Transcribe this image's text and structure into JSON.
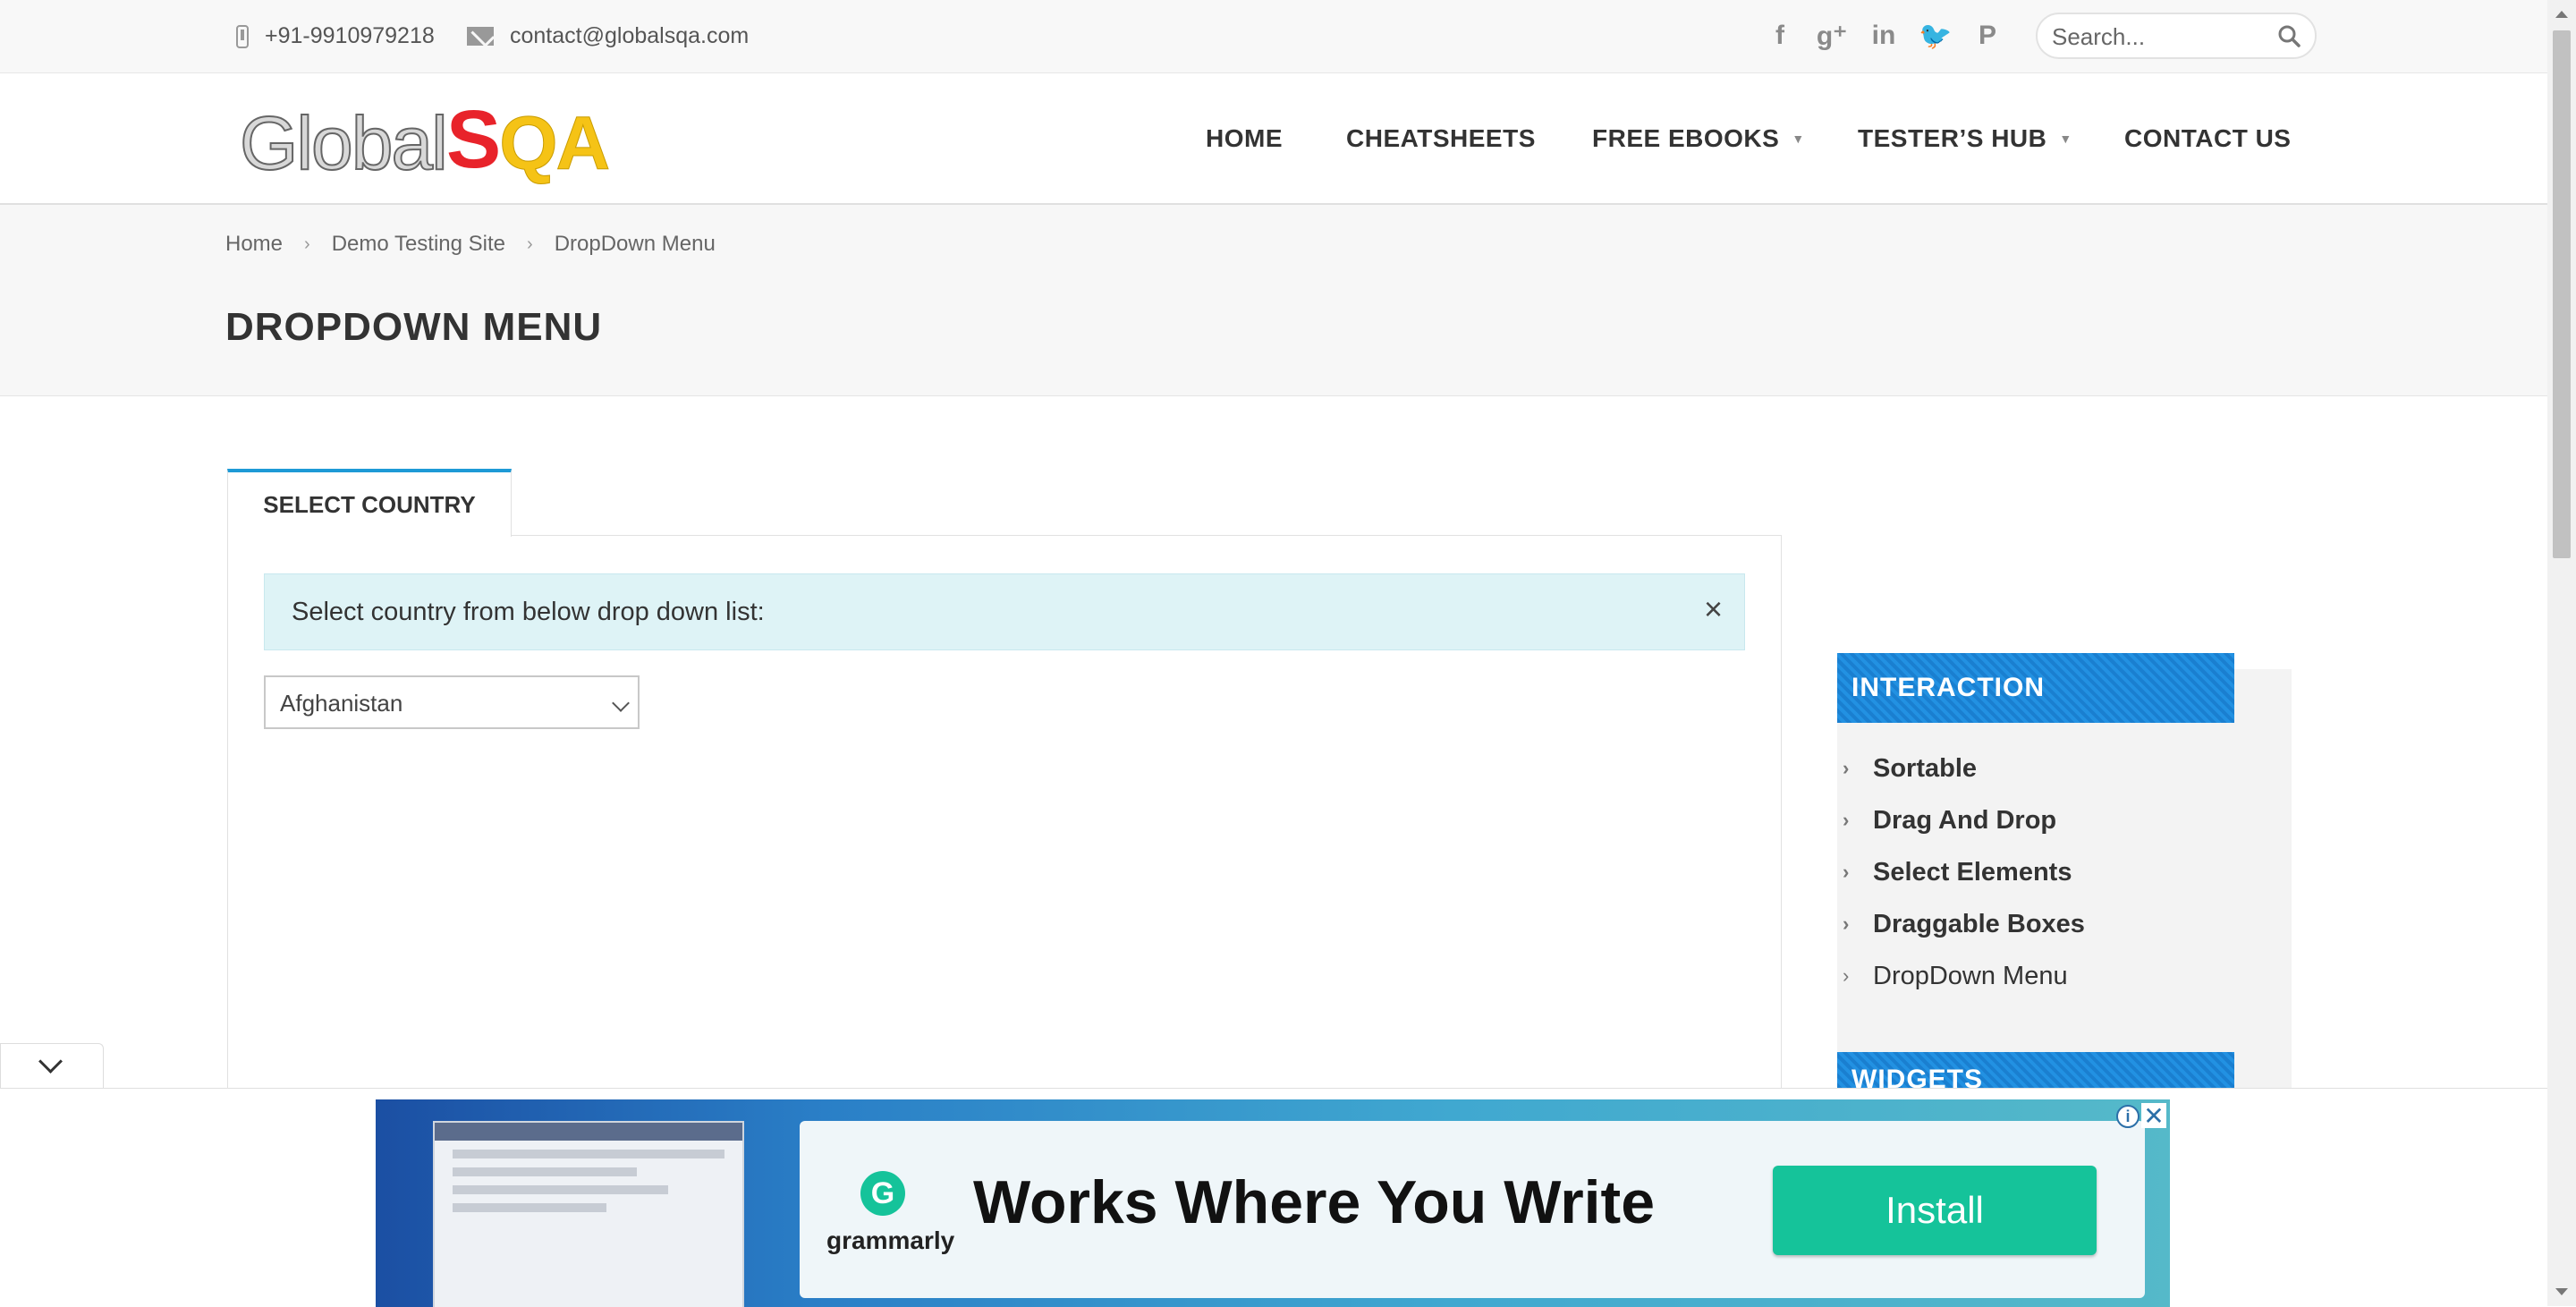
{
  "topbar": {
    "phone": "+91-9910979218",
    "email": "contact@globalsqa.com",
    "social": [
      {
        "icon": "facebook-icon",
        "glyph": "f"
      },
      {
        "icon": "google-plus-icon",
        "glyph": "g⁺"
      },
      {
        "icon": "linkedin-icon",
        "glyph": "in"
      },
      {
        "icon": "twitter-icon",
        "glyph": "🐦"
      },
      {
        "icon": "pinterest-icon",
        "glyph": "P"
      }
    ],
    "search_placeholder": "Search..."
  },
  "header": {
    "logo": {
      "part1": "Global",
      "part2": "S",
      "part3": "QA"
    },
    "nav": [
      "HOME",
      "CHEATSHEETS",
      "FREE EBOOKS",
      "TESTER’S HUB",
      "CONTACT US"
    ]
  },
  "breadcrumb": [
    "Home",
    "Demo Testing Site",
    "DropDown Menu"
  ],
  "page_title": "DROPDOWN MENU",
  "main": {
    "tab_label": "SELECT COUNTRY",
    "alert_text": "Select country from below drop down list:",
    "alert_close": "×",
    "select_value": "Afghanistan"
  },
  "sidebar": {
    "interaction_title": "INTERACTION",
    "items": [
      "Sortable",
      "Drag And Drop",
      "Select Elements",
      "Draggable Boxes",
      "DropDown Menu"
    ],
    "widgets_title": "WIDGETS"
  },
  "ad": {
    "brand": "grammarly",
    "logo_letter": "G",
    "headline": "Works Where You Write",
    "button": "Install"
  },
  "colors": {
    "accent": "#1e9ad6",
    "widget_header": "#1a7fd0",
    "grammarly_green": "#15c39a",
    "alert_bg": "#def3f6"
  }
}
